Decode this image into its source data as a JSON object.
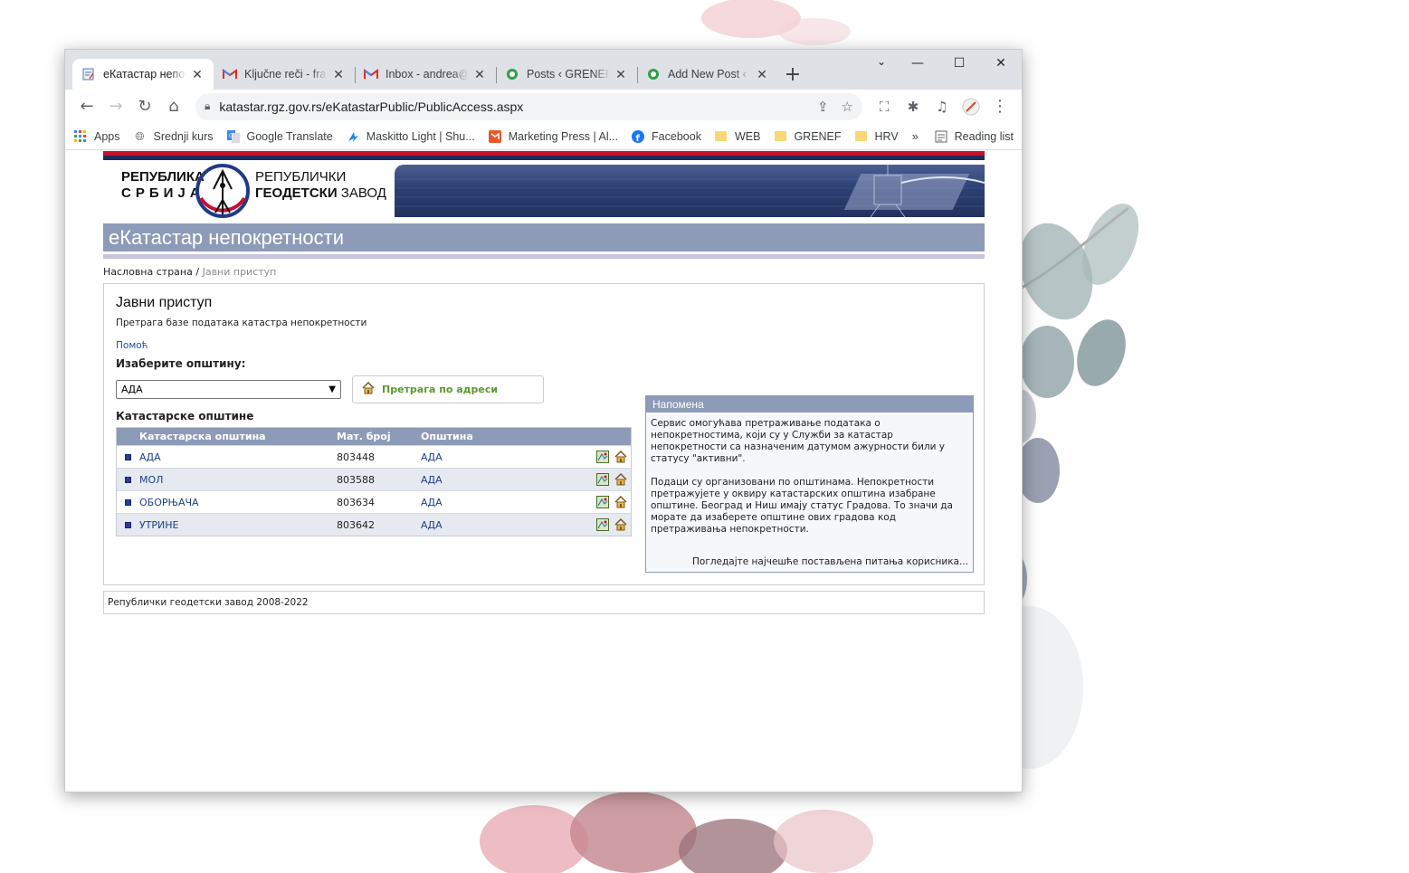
{
  "browser": {
    "tabs": [
      {
        "label": "еКатастар непок",
        "active": true,
        "icon": "ekatastar-favicon"
      },
      {
        "label": "Ključne reči - fraz",
        "active": false,
        "icon": "gmail-icon"
      },
      {
        "label": "Inbox - andrea@",
        "active": false,
        "icon": "gmail-icon"
      },
      {
        "label": "Posts ‹ GRENEF —",
        "active": false,
        "icon": "grenef-icon"
      },
      {
        "label": "Add New Post ‹ G",
        "active": false,
        "icon": "grenef-icon"
      }
    ],
    "url": "katastar.rgz.gov.rs/eKatastarPublic/PublicAccess.aspx",
    "bookmarks": [
      {
        "label": "Apps",
        "icon": "apps-grid-icon"
      },
      {
        "label": "Srednji kurs",
        "icon": "globe-icon"
      },
      {
        "label": "Google Translate",
        "icon": "translate-icon"
      },
      {
        "label": "Maskitto Light | Shu...",
        "icon": "maskitto-icon"
      },
      {
        "label": "Marketing Press | Al...",
        "icon": "marketing-icon"
      },
      {
        "label": "Facebook",
        "icon": "facebook-icon"
      },
      {
        "label": "WEB",
        "icon": "folder-icon"
      },
      {
        "label": "GRENEF",
        "icon": "folder-icon"
      },
      {
        "label": "HRV",
        "icon": "folder-icon"
      }
    ],
    "overflow_label": "»",
    "reading_list": "Reading list"
  },
  "banner": {
    "left_line1": "РЕПУБЛИКА",
    "left_line2": "СРБИЈА",
    "right_line1": "РЕПУБЛИЧКИ",
    "right_line2": "ГЕОДЕТСКИ",
    "right_line2b": "ЗАВОД"
  },
  "header": {
    "title": "еКатастар непокретности"
  },
  "breadcrumb": {
    "home": "Насловна страна",
    "sep": "/",
    "current": "Јавни приступ"
  },
  "main": {
    "title": "Јавни приступ",
    "subtitle": "Претрага базе података катастра непокретности",
    "help": "Помоћ",
    "choose_label": "Изаберите општину:",
    "select_value": "АДА",
    "address_search": "Претрага по адреси",
    "ko_label": "Катастарске општине",
    "table": {
      "headers": [
        "Катастарска општина",
        "Мат. број",
        "Општина"
      ],
      "rows": [
        {
          "name": "АДА",
          "mb": "803448",
          "op": "АДА"
        },
        {
          "name": "МОЛ",
          "mb": "803588",
          "op": "АДА"
        },
        {
          "name": "ОБОРЊАЧА",
          "mb": "803634",
          "op": "АДА"
        },
        {
          "name": "УТРИНЕ",
          "mb": "803642",
          "op": "АДА"
        }
      ]
    }
  },
  "note": {
    "title": "Напомена",
    "p1": "Сервис омогућава претраживање података о непокретностима, који су у Служби за катастар непокретности са назначеним датумом ажурности били у статусу \"активни\".",
    "p2": "Подаци су организовани по општинама. Непокретности претражујете у оквиру катастарских општина изабране општине. Београд и Ниш имају статус Градова. То значи да морате да изаберете општине ових градова код претраживања непокретности.",
    "faq": "Погледајте најчешће постављена питања корисника..."
  },
  "footer": {
    "text": "Републички геодетски завод 2008-2022"
  },
  "colors": {
    "accent_bar": "#8e9bb8",
    "red": "#c8102e",
    "navy": "#1f2a5a",
    "link": "#1f3f8a",
    "green": "#5a9a2c"
  }
}
